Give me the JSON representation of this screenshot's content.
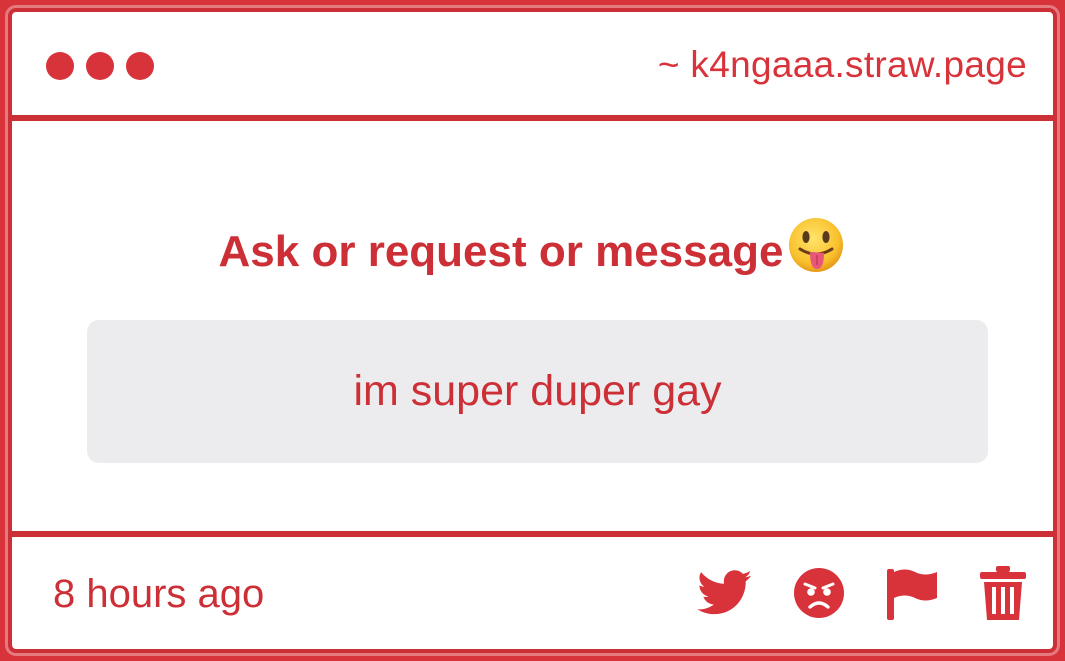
{
  "header": {
    "site": "~ k4ngaaa.straw.page"
  },
  "card": {
    "prompt": "Ask or request or message",
    "prompt_emoji": "tongue-face-emoji",
    "message": "im super duper gay"
  },
  "footer": {
    "time": "8 hours ago",
    "actions": [
      "twitter-icon",
      "angry-face-icon",
      "flag-icon",
      "trash-icon"
    ]
  },
  "colors": {
    "accent": "#d8333a",
    "message_bg": "#ecebed",
    "background": "#ffffff"
  }
}
